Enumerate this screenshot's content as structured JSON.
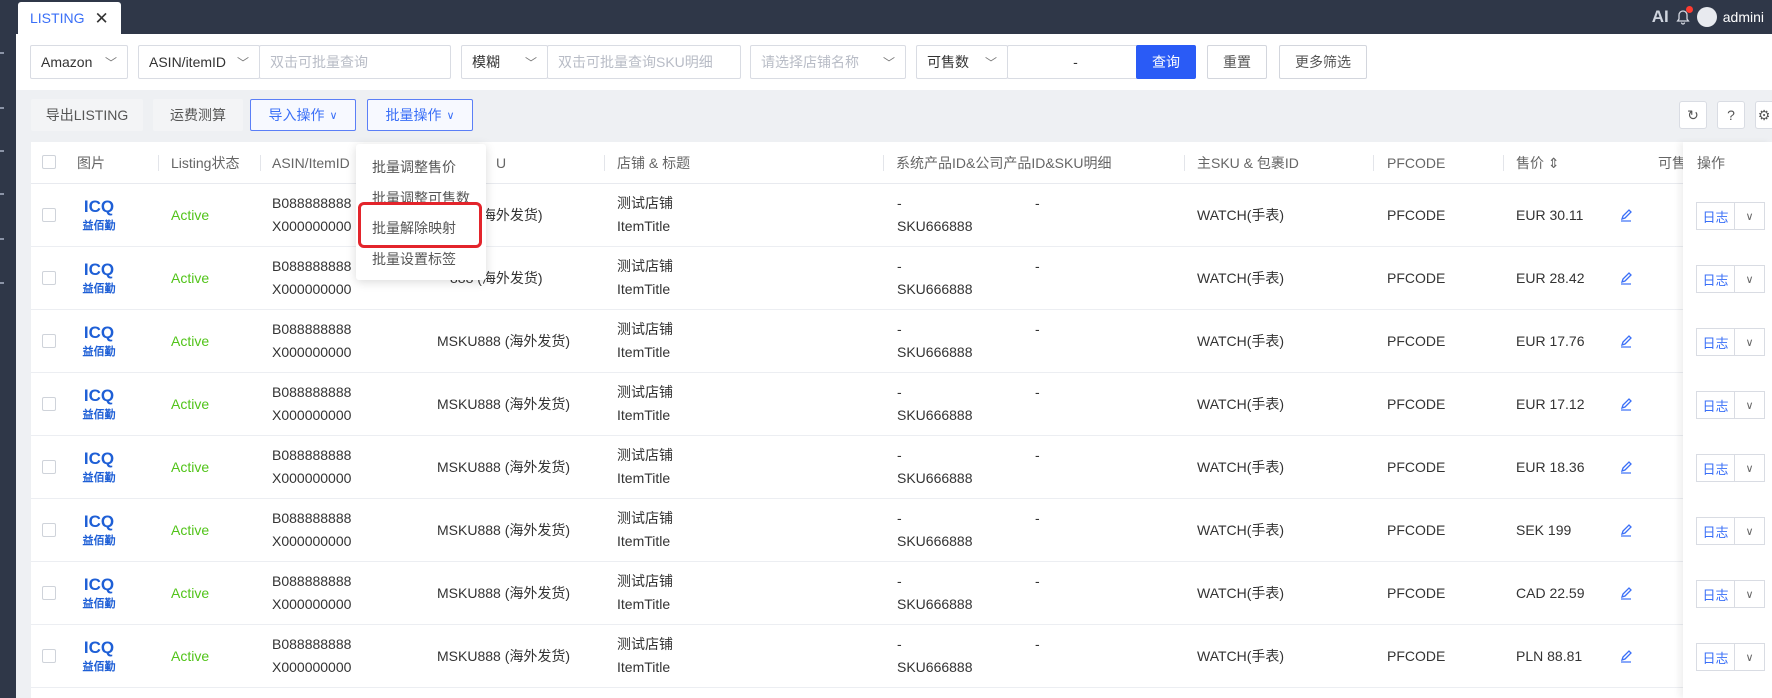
{
  "tab": {
    "title": "LISTING",
    "close": "✕"
  },
  "topbar": {
    "ai": "AI",
    "user": "admini"
  },
  "filters": {
    "platform": "Amazon",
    "id_type": "ASIN/itemID",
    "id_placeholder": "双击可批量查询",
    "match_mode": "模糊",
    "sku_placeholder": "双击可批量查询SKU明细",
    "store_placeholder": "请选择店铺名称",
    "qty_field": "可售数",
    "range_separator": "-",
    "search_btn": "查询",
    "reset_btn": "重置",
    "more_btn": "更多筛选"
  },
  "toolbar": {
    "export": "导出LISTING",
    "freight": "运费测算",
    "import": "导入操作",
    "batch": "批量操作"
  },
  "dropdown": {
    "items": [
      "批量调整售价",
      "批量调整可售数",
      "批量解除映射",
      "批量设置标签"
    ]
  },
  "table": {
    "headers": {
      "image": "图片",
      "status": "Listing状态",
      "asin": "ASIN/ItemID",
      "msku": "U",
      "store": "店铺 & 标题",
      "sys": "系统产品ID&公司产品ID&SKU明细",
      "main_sku": "主SKU & 包裹ID",
      "pfcode": "PFCODE",
      "price": "售价 ⇕",
      "avail": "可售",
      "ops": "操作"
    },
    "rows": [
      {
        "logo": "益佰勤",
        "status": "Active",
        "asin1": "B088888888",
        "asin2": "X000000000",
        "msku": "888 (海外发货)",
        "store": "测试店铺",
        "title": "ItemTitle",
        "sys1": "-",
        "sys2": "SKU666888",
        "sys3": "-",
        "main_sku": "WATCH(手表)",
        "pfcode": "PFCODE",
        "price": "EUR 30.11",
        "op": "日志"
      },
      {
        "logo": "益佰勤",
        "status": "Active",
        "asin1": "B088888888",
        "asin2": "X000000000",
        "msku": "888 (海外发货)",
        "store": "测试店铺",
        "title": "ItemTitle",
        "sys1": "-",
        "sys2": "SKU666888",
        "sys3": "-",
        "main_sku": "WATCH(手表)",
        "pfcode": "PFCODE",
        "price": "EUR 28.42",
        "op": "日志"
      },
      {
        "logo": "益佰勤",
        "status": "Active",
        "asin1": "B088888888",
        "asin2": "X000000000",
        "msku": "MSKU888 (海外发货)",
        "store": "测试店铺",
        "title": "ItemTitle",
        "sys1": "-",
        "sys2": "SKU666888",
        "sys3": "-",
        "main_sku": "WATCH(手表)",
        "pfcode": "PFCODE",
        "price": "EUR 17.76",
        "op": "日志"
      },
      {
        "logo": "益佰勤",
        "status": "Active",
        "asin1": "B088888888",
        "asin2": "X000000000",
        "msku": "MSKU888 (海外发货)",
        "store": "测试店铺",
        "title": "ItemTitle",
        "sys1": "-",
        "sys2": "SKU666888",
        "sys3": "-",
        "main_sku": "WATCH(手表)",
        "pfcode": "PFCODE",
        "price": "EUR 17.12",
        "op": "日志"
      },
      {
        "logo": "益佰勤",
        "status": "Active",
        "asin1": "B088888888",
        "asin2": "X000000000",
        "msku": "MSKU888 (海外发货)",
        "store": "测试店铺",
        "title": "ItemTitle",
        "sys1": "-",
        "sys2": "SKU666888",
        "sys3": "-",
        "main_sku": "WATCH(手表)",
        "pfcode": "PFCODE",
        "price": "EUR 18.36",
        "op": "日志"
      },
      {
        "logo": "益佰勤",
        "status": "Active",
        "asin1": "B088888888",
        "asin2": "X000000000",
        "msku": "MSKU888 (海外发货)",
        "store": "测试店铺",
        "title": "ItemTitle",
        "sys1": "-",
        "sys2": "SKU666888",
        "sys3": "-",
        "main_sku": "WATCH(手表)",
        "pfcode": "PFCODE",
        "price": "SEK 199",
        "op": "日志"
      },
      {
        "logo": "益佰勤",
        "status": "Active",
        "asin1": "B088888888",
        "asin2": "X000000000",
        "msku": "MSKU888 (海外发货)",
        "store": "测试店铺",
        "title": "ItemTitle",
        "sys1": "-",
        "sys2": "SKU666888",
        "sys3": "-",
        "main_sku": "WATCH(手表)",
        "pfcode": "PFCODE",
        "price": "CAD 22.59",
        "op": "日志"
      },
      {
        "logo": "益佰勤",
        "status": "Active",
        "asin1": "B088888888",
        "asin2": "X000000000",
        "msku": "MSKU888 (海外发货)",
        "store": "测试店铺",
        "title": "ItemTitle",
        "sys1": "-",
        "sys2": "SKU666888",
        "sys3": "-",
        "main_sku": "WATCH(手表)",
        "pfcode": "PFCODE",
        "price": "PLN 88.81",
        "op": "日志"
      }
    ]
  },
  "colors": {
    "primary": "#2a5bf6",
    "topbar": "#2f3748",
    "active": "#52c41a",
    "highlight": "#e3242b"
  }
}
